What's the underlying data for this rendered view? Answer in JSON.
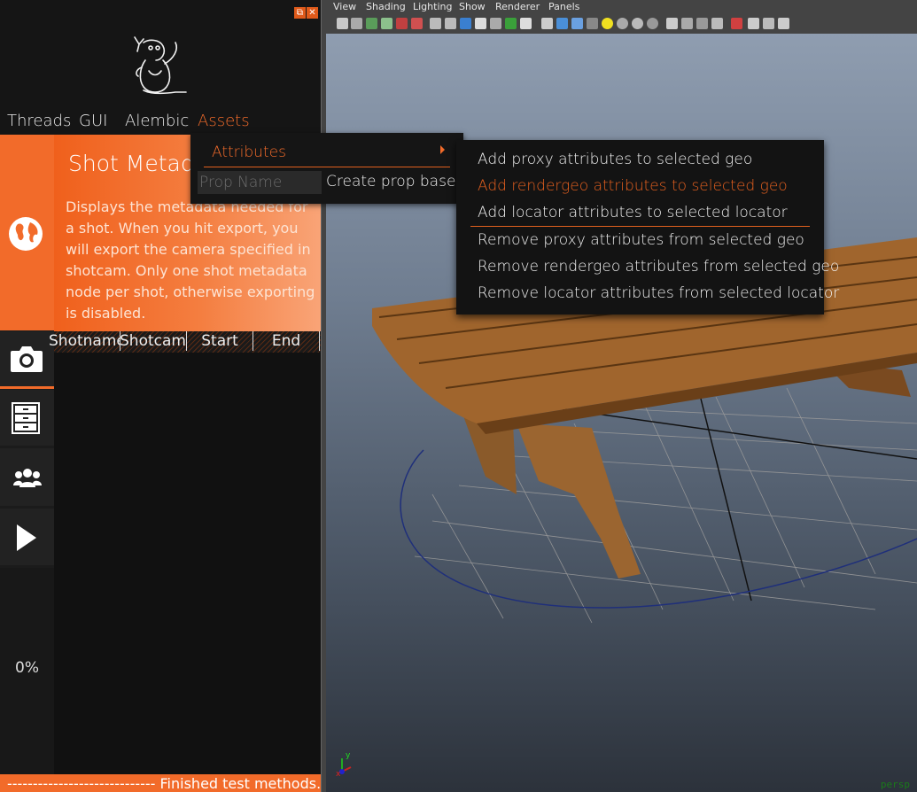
{
  "tool_panel": {
    "window_controls": {
      "float_label": "⧉",
      "close_label": "✕"
    },
    "menu": [
      "Threads",
      "GUI",
      "Alembic",
      "Assets"
    ],
    "active_menu": "Assets",
    "side_tabs": [
      "globe-icon",
      "camera-icon",
      "drawers-icon",
      "users-icon",
      "play-icon"
    ],
    "card": {
      "title": "Shot Metadata",
      "description": "Displays the metadata needed for a shot. When you hit export, you will export the camera specified in shotcam. Only one shot metadata node per shot, otherwise exporting is disabled."
    },
    "table_headers": [
      "Shotname",
      "Shotcam",
      "Start",
      "End"
    ],
    "progress": "0%",
    "status": "----------------------------- Finished test methods."
  },
  "assets_menu": {
    "attributes_label": "Attributes",
    "prop_name_placeholder": "Prop Name",
    "create_prop_label": "Create prop base"
  },
  "attributes_submenu": {
    "items": [
      "Add proxy attributes to selected geo",
      "Add rendergeo attributes to selected geo",
      "Add locator attributes to selected locator",
      "Remove proxy attributes from selected geo",
      "Remove rendergeo attributes from selected geo",
      "Remove locator attributes from selected locator"
    ],
    "highlighted_index": 1
  },
  "viewport": {
    "menus": [
      "View",
      "Shading",
      "Lighting",
      "Show",
      "Renderer",
      "Panels"
    ],
    "camera_label": "persp",
    "axis_labels": {
      "y": "y",
      "x": "x"
    }
  },
  "colors": {
    "accent": "#f26b2a",
    "panel_bg": "#151515",
    "viewport_top": "#8f9db0",
    "viewport_bottom": "#2c323b"
  }
}
